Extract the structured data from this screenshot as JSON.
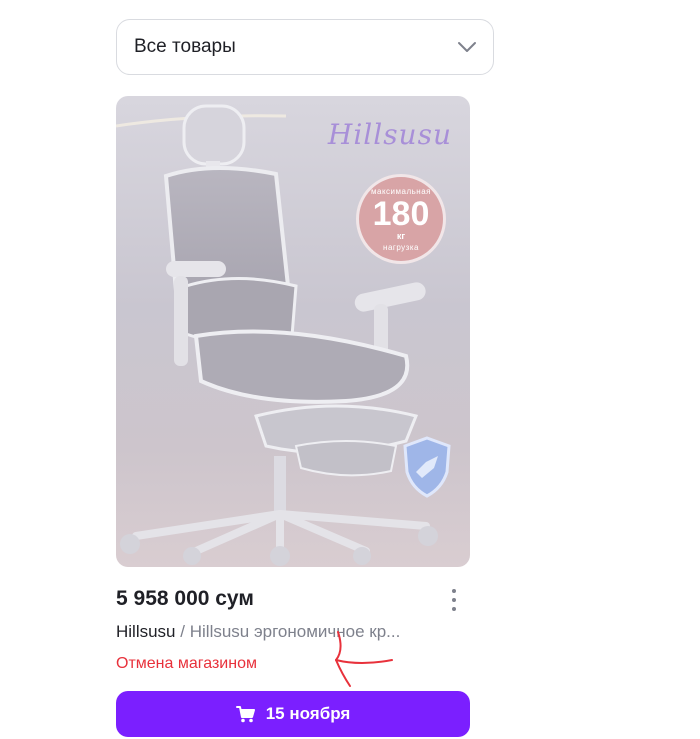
{
  "filter": {
    "selected": "Все товары"
  },
  "product": {
    "image": {
      "brand_logo": "Hillsusu",
      "badge_top": "максимальная",
      "badge_value": "180",
      "badge_unit": "кг",
      "badge_bottom": "нагрузка"
    },
    "price": "5 958 000 сум",
    "brand": "Hillsusu",
    "separator": "/",
    "name": "Hillsusu эргономичное кр...",
    "status": "Отмена магазином",
    "status_color": "#e8313b",
    "delivery_label": "15 ноября",
    "button_color": "#7b1fff"
  },
  "icons": {
    "dropdown": "chevron-down-icon",
    "more": "kebab-menu-icon",
    "cart": "cart-icon"
  }
}
